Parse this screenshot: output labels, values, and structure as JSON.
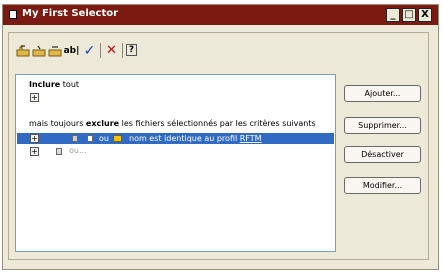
{
  "window": {
    "title": "My First Selector",
    "controls": [
      "_",
      "□",
      "X"
    ]
  },
  "toolbar": {
    "items": [
      {
        "name": "open-file-icon"
      },
      {
        "name": "open-file-2-icon"
      },
      {
        "name": "open-file-3-icon"
      },
      {
        "name": "rename-icon",
        "label": "ab|"
      },
      {
        "name": "check-icon",
        "label": "✓"
      },
      {
        "name": "delete-icon",
        "label": "✕"
      },
      {
        "name": "help-icon",
        "label": "?"
      }
    ]
  },
  "list": {
    "include_bold": "Inclure",
    "include_rest": "tout",
    "exclude_prefix": "mais toujours",
    "exclude_bold": "exclure",
    "exclude_suffix": "les fichiers sélectionnés par les critères suivants",
    "row1_ou": "ou",
    "row1_text": "nom est identique au profil",
    "row1_value": "RFTM",
    "row2_ou": "ou..."
  },
  "buttons": {
    "add": "Ajouter...",
    "delete": "Supprimer...",
    "deactivate": "Désactiver",
    "modify": "Modifier..."
  },
  "colors": {
    "titlebar": "#7a1a10",
    "selection": "#316ac5"
  }
}
